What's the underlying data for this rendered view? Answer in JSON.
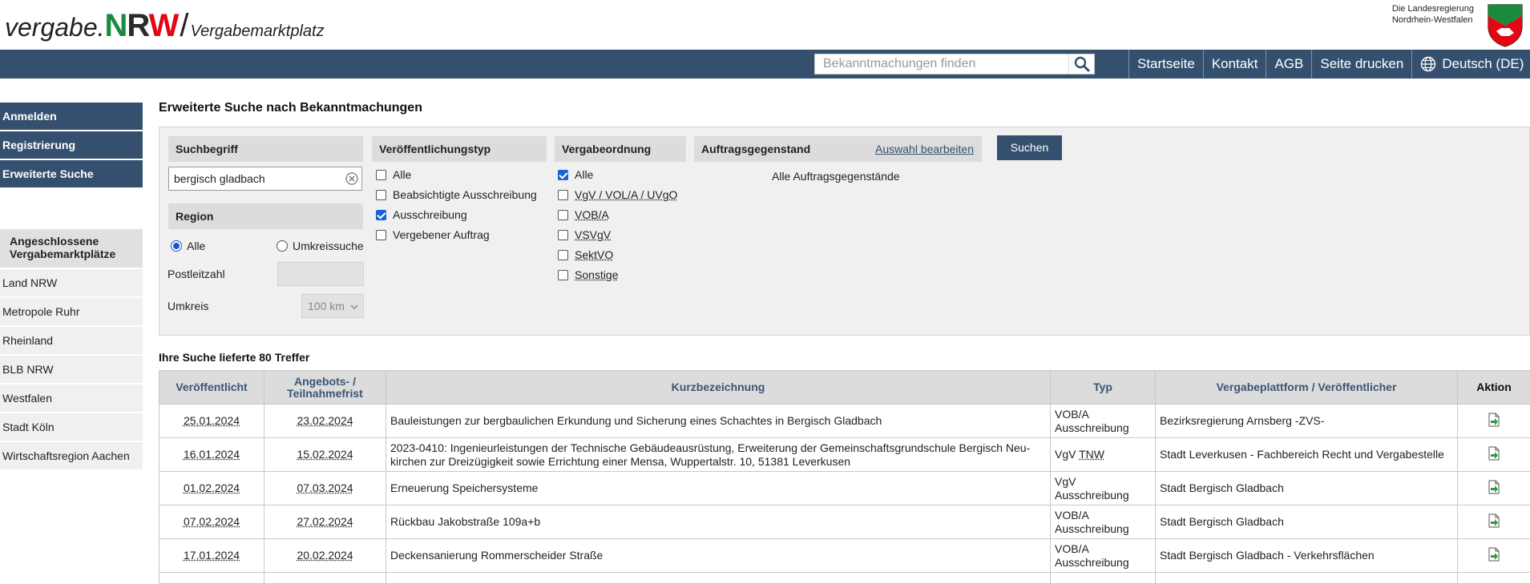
{
  "header": {
    "brand_part1": "vergabe.",
    "brand_n": "N",
    "brand_r": "R",
    "brand_w": "W",
    "brand_slash": "/",
    "brand_part3": "Vergabemarktplatz",
    "gov_line1": "Die Landesregierung",
    "gov_line2": "Nordrhein-Westfalen"
  },
  "topnav": {
    "search_placeholder": "Bekanntmachungen finden",
    "links": [
      "Startseite",
      "Kontakt",
      "AGB",
      "Seite drucken"
    ],
    "language": "Deutsch (DE)"
  },
  "sidebar": {
    "buttons": [
      "Anmelden",
      "Registrierung",
      "Erweiterte Suche"
    ],
    "section_title_line1": "Angeschlossene",
    "section_title_line2": "Vergabemarktplätze",
    "items": [
      "Land NRW",
      "Metropole Ruhr",
      "Rheinland",
      "BLB NRW",
      "Westfalen",
      "Stadt Köln",
      "Wirtschaftsregion Aachen"
    ]
  },
  "main": {
    "title": "Erweiterte Suche nach Bekanntmachungen",
    "suchbegriff_label": "Suchbegriff",
    "suchbegriff_value": "bergisch gladbach",
    "region_label": "Region",
    "radio_alle": "Alle",
    "radio_umkreis": "Umkreissuche",
    "postleitzahl_label": "Postleitzahl",
    "umkreis_label": "Umkreis",
    "umkreis_value": "100 km",
    "veroeff_label": "Veröffentlichungstyp",
    "veroeff_options": [
      "Alle",
      "Beabsichtigte Ausschreibung",
      "Ausschreibung",
      "Vergebener Auftrag"
    ],
    "vergabe_label": "Vergabeordnung",
    "vergabe_options": [
      "Alle",
      "VgV / VOL/A / UVgO",
      "VOB/A",
      "VSVgV",
      "SektVO",
      "Sonstige"
    ],
    "auftrag_label": "Auftragsgegenstand",
    "auftrag_link": "Auswahl bearbeiten",
    "auftrag_value": "Alle Auftragsgegenstände",
    "search_button": "Suchen",
    "results_title": "Ihre Suche lieferte 80 Treffer"
  },
  "table": {
    "headers": [
      "Veröffentlicht",
      "Angebots- /",
      "Teilnahmefrist",
      "Kurzbezeichnung",
      "Typ",
      "Vergabeplattform / Veröffentlicher",
      "Aktion"
    ],
    "rows": [
      {
        "pub": "25.01.2024",
        "frist": "23.02.2024",
        "kurz": "Bauleistungen zur bergbaulichen Erkundung und Sicherung eines Schachtes in Bergisch Gladbach",
        "typ1": "VOB/A",
        "typ2": "Ausschreibung",
        "platform": "Bezirksregierung Arnsberg -ZVS-"
      },
      {
        "pub": "16.01.2024",
        "frist": "15.02.2024",
        "kurz": "2023-0410: Ingenieurleistungen der Technische Gebäudeausrüstung, Erweiterung der Gemeinschaftsgrundschule Bergisch Neu-kirchen zur Dreizügigkeit sowie Errichtung einer Mensa, Wuppertalstr. 10, 51381 Leverkusen",
        "typ1": "VgV",
        "typ2": "TNW",
        "platform": "Stadt Leverkusen - Fachbereich Recht und Vergabestelle"
      },
      {
        "pub": "01.02.2024",
        "frist": "07.03.2024",
        "kurz": "Erneuerung Speichersysteme",
        "typ1": "VgV",
        "typ2": "Ausschreibung",
        "platform": "Stadt Bergisch Gladbach"
      },
      {
        "pub": "07.02.2024",
        "frist": "27.02.2024",
        "kurz": "Rückbau Jakobstraße 109a+b",
        "typ1": "VOB/A",
        "typ2": "Ausschreibung",
        "platform": "Stadt Bergisch Gladbach"
      },
      {
        "pub": "17.01.2024",
        "frist": "20.02.2024",
        "kurz": "Deckensanierung Rommerscheider Straße",
        "typ1": "VOB/A",
        "typ2": "Ausschreibung",
        "platform": "Stadt Bergisch Gladbach - Verkehrsflächen"
      }
    ]
  },
  "colors": {
    "nav_bg": "#35506e",
    "accent_green": "#1a8a3c",
    "accent_red": "#e30613",
    "panel_bg": "#f0f0f0",
    "header_cell_bg": "#dcdcdc",
    "checkbox_blue": "#1a63d6"
  }
}
